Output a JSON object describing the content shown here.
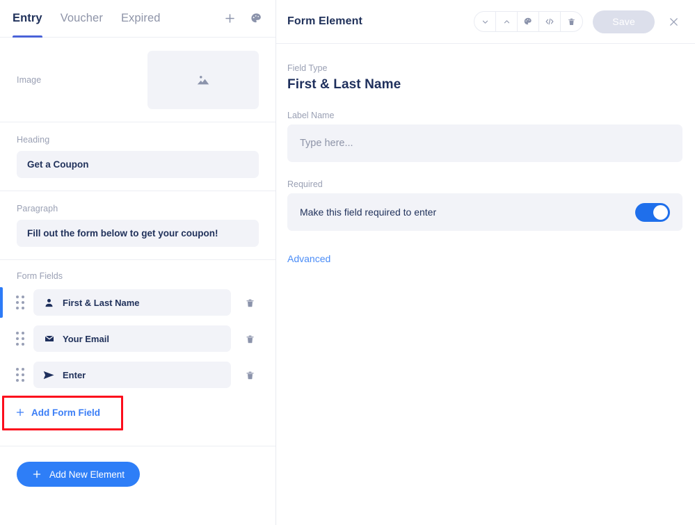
{
  "left_panel": {
    "tabs": [
      {
        "label": "Entry",
        "active": true
      },
      {
        "label": "Voucher",
        "active": false
      },
      {
        "label": "Expired",
        "active": false
      }
    ],
    "header_actions": [
      {
        "name": "add-icon",
        "glyph": "+"
      },
      {
        "name": "palette-icon",
        "glyph": "palette"
      }
    ],
    "image_section": {
      "label": "Image",
      "placeholder_icon": "image-placeholder-icon"
    },
    "heading_section": {
      "label": "Heading",
      "value": "Get a Coupon"
    },
    "paragraph_section": {
      "label": "Paragraph",
      "value": "Fill out the form below to get your coupon!"
    },
    "form_fields_section": {
      "label": "Form Fields",
      "fields": [
        {
          "label": "First & Last Name",
          "icon": "person-icon",
          "active": true
        },
        {
          "label": "Your Email",
          "icon": "envelope-icon",
          "active": false
        },
        {
          "label": "Enter",
          "icon": "paper-plane-icon",
          "active": false
        }
      ],
      "add_field_label": "Add Form Field",
      "add_field_icon": "plus-icon",
      "highlighted": true,
      "highlight_color": "#fc0d1c"
    },
    "add_element_button": {
      "label": "Add New Element",
      "icon": "plus-icon",
      "color": "#2e7ef7"
    }
  },
  "right_panel": {
    "title": "Form Element",
    "toolbar_icons": [
      {
        "name": "chevron-down-icon"
      },
      {
        "name": "chevron-up-icon"
      },
      {
        "name": "palette-icon"
      },
      {
        "name": "code-icon"
      },
      {
        "name": "trash-icon"
      }
    ],
    "save_button": {
      "label": "Save",
      "disabled": true,
      "color": "#dcdfeb"
    },
    "close_icon": "close-icon",
    "field_type": {
      "label": "Field Type",
      "value": "First & Last Name"
    },
    "label_name": {
      "label": "Label Name",
      "value": "",
      "placeholder": "Type here..."
    },
    "required": {
      "label": "Required",
      "toggle_label": "Make this field required to enter",
      "enabled": true,
      "toggle_color": "#1f6feb"
    },
    "advanced_link": "Advanced"
  }
}
